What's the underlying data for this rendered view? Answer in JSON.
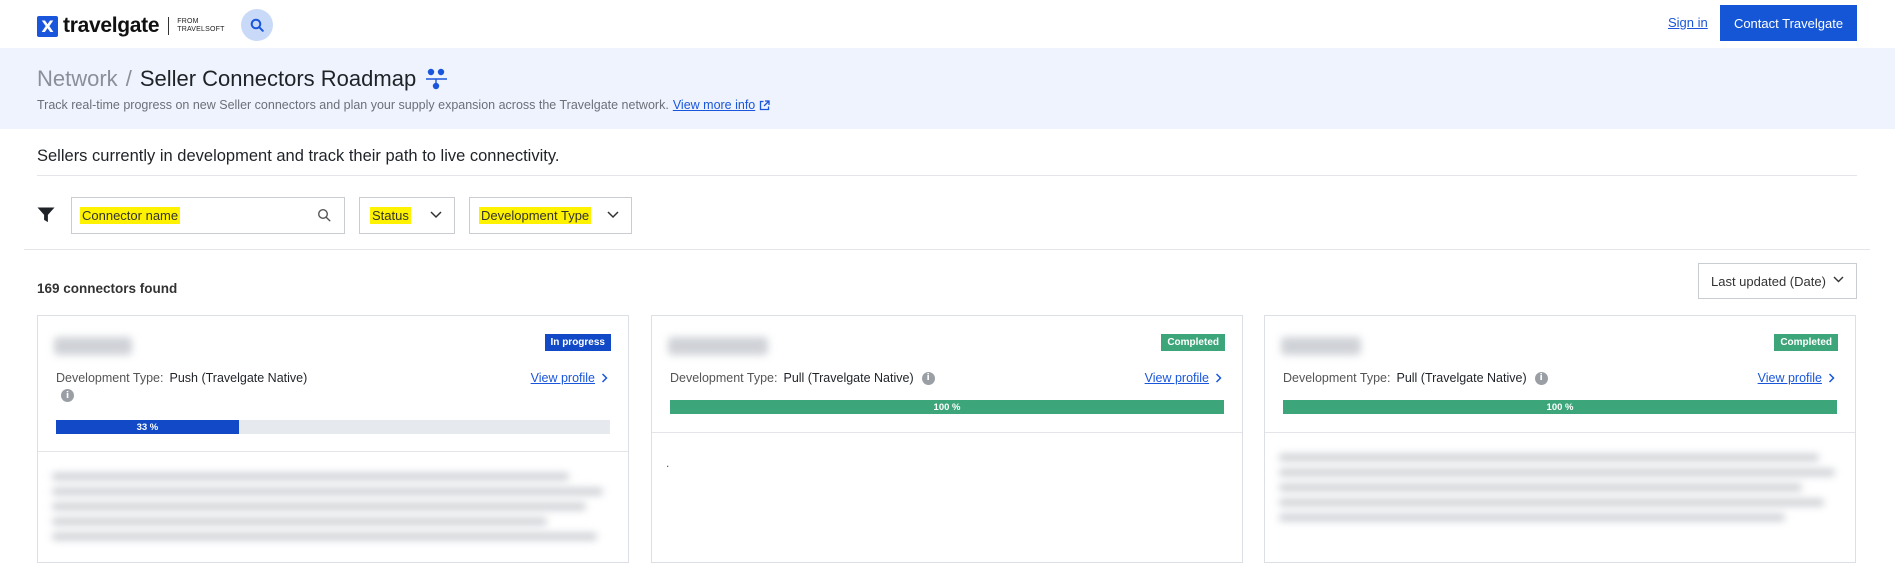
{
  "nav": {
    "brand": "travelgate",
    "from_line1": "FROM",
    "from_line2": "TRAVELSOFT",
    "signin": "Sign in",
    "contact": "Contact Travelgate"
  },
  "hero": {
    "crumb_network": "Network",
    "crumb_sep": "/",
    "title": "Seller Connectors Roadmap",
    "description": "Track real-time progress on new Seller connectors and plan your supply expansion across the Travelgate network.",
    "more_link": "View more info"
  },
  "subtitle": "Sellers currently in development and track their path to live connectivity.",
  "filters": {
    "search_placeholder": "Connector name",
    "status": "Status",
    "dev_type": "Development Type"
  },
  "results": {
    "count": "169 connectors found",
    "sort": "Last updated (Date)"
  },
  "cards": [
    {
      "status": "In progress",
      "dev_label": "Development Type:",
      "dev_value": "Push (Travelgate Native)",
      "view_profile": "View profile",
      "progress": 33,
      "progress_label": "33 %"
    },
    {
      "status": "Completed",
      "dev_label": "Development Type:",
      "dev_value": "Pull (Travelgate Native)",
      "view_profile": "View profile",
      "progress": 100,
      "progress_label": "100 %",
      "note": "."
    },
    {
      "status": "Completed",
      "dev_label": "Development Type:",
      "dev_value": "Pull (Travelgate Native)",
      "view_profile": "View profile",
      "progress": 100,
      "progress_label": "100 %"
    }
  ],
  "colors": {
    "primary": "#1556d6",
    "in_progress": "#1149c7",
    "completed": "#3da57a",
    "hero_bg": "#eef3fd",
    "highlight": "#fff200"
  },
  "icons": {
    "nav_search": "search-icon",
    "filter": "filter-icon",
    "external": "external-link-icon",
    "info": "info-icon",
    "chevron": "chevron-down-icon"
  }
}
